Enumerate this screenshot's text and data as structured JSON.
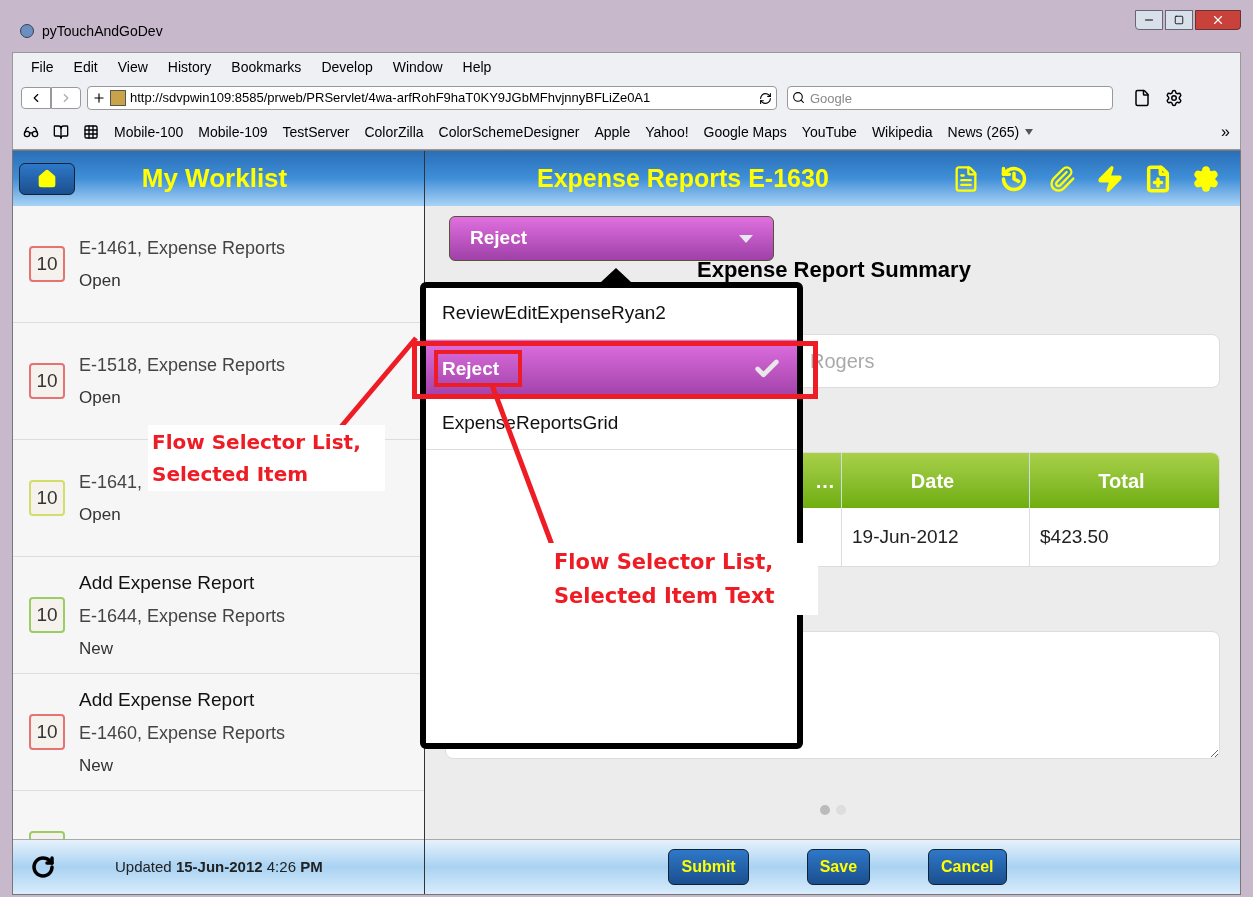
{
  "window": {
    "title": "pyTouchAndGoDev"
  },
  "menu": [
    "File",
    "Edit",
    "View",
    "History",
    "Bookmarks",
    "Develop",
    "Window",
    "Help"
  ],
  "address_bar": {
    "url": "http://sdvpwin109:8585/prweb/PRServlet/4wa-arfRohF9haT0KY9JGbMFhvjnnyBFLiZe0A1",
    "search_placeholder": "Google"
  },
  "bookmarks": [
    "Mobile-100",
    "Mobile-109",
    "TestServer",
    "ColorZilla",
    "ColorSchemeDesigner",
    "Apple",
    "Yahoo!",
    "Google Maps",
    "YouTube",
    "Wikipedia",
    "News (265)"
  ],
  "bookmarks_more": "»",
  "worklist": {
    "title": "My Worklist",
    "items": [
      {
        "badge": "10",
        "color": "#e57373",
        "line": "E-1461, Expense Reports",
        "status": "Open"
      },
      {
        "badge": "10",
        "color": "#e57373",
        "line": "E-1518, Expense Reports",
        "status": "Open"
      },
      {
        "badge": "10",
        "color": "#d4dc6a",
        "line": "E-1641,",
        "status": "Open"
      },
      {
        "badge": "10",
        "color": "#9ccc65",
        "title": "Add Expense Report",
        "line": "E-1644, Expense Reports",
        "status": "New"
      },
      {
        "badge": "10",
        "color": "#e57373",
        "title": "Add Expense Report",
        "line": "E-1460, Expense Reports",
        "status": "New"
      },
      {
        "color": "#9ccc65"
      }
    ],
    "updated": "Updated **15-Jun-2012** 4:26 **PM**"
  },
  "case": {
    "title": "Expense Reports E-1630",
    "flow_selector": {
      "value": "Reject",
      "options": [
        {
          "label": "ReviewEditExpenseRyan2",
          "selected": false
        },
        {
          "label": "Reject",
          "selected": true
        },
        {
          "label": "ExpenseReportsGrid",
          "selected": false
        }
      ]
    },
    "heading": "Expense Report Summary",
    "field_value": "Rogers",
    "table": {
      "columns": [
        "…",
        "Date",
        "Total"
      ],
      "rows": [
        [
          "",
          "19-Jun-2012",
          "$423.50"
        ]
      ]
    },
    "buttons": [
      "Submit",
      "Save",
      "Cancel"
    ]
  },
  "annotations": [
    "Flow Selector List, Selected Item",
    "Flow Selector List, Selected Item Text"
  ]
}
